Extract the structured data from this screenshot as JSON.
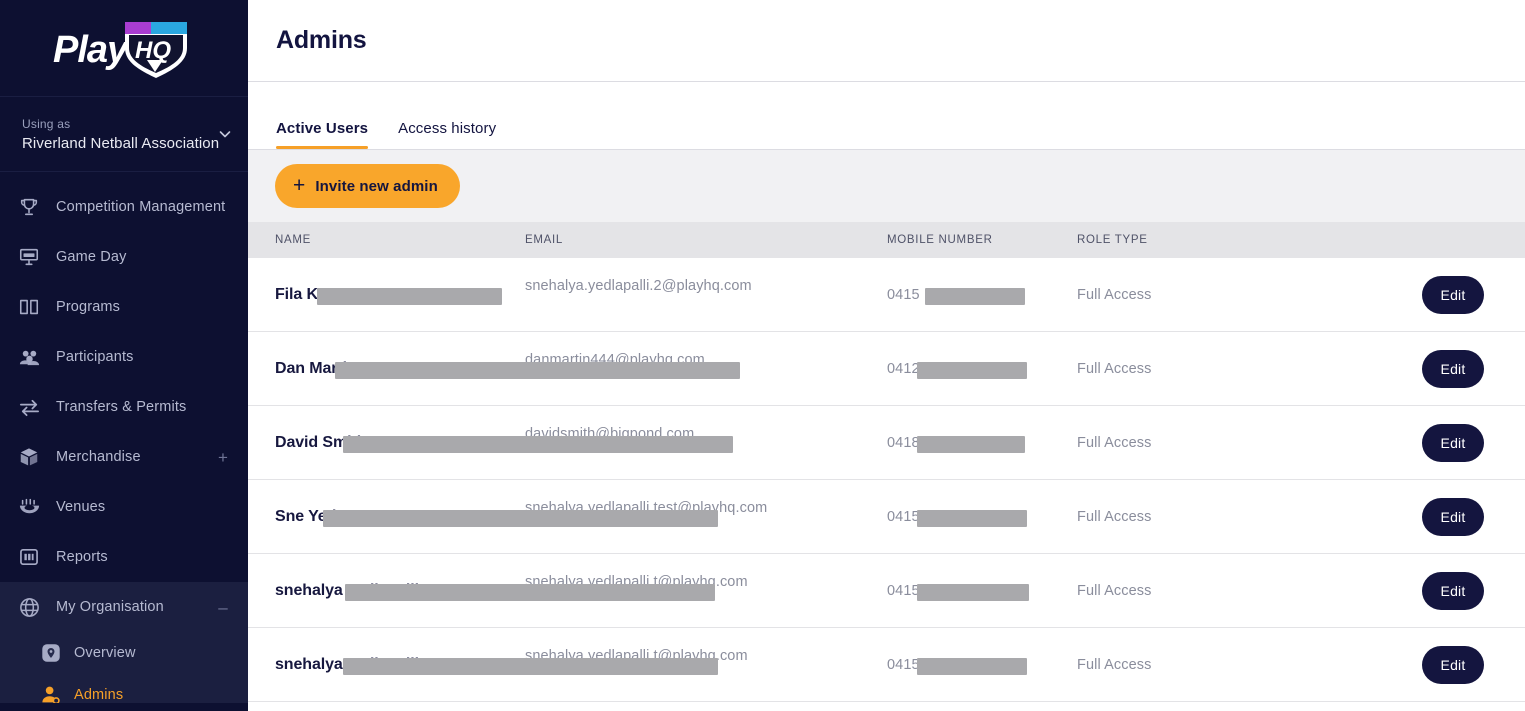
{
  "sidebar": {
    "logo_alt": "PlayHQ",
    "org_switcher": {
      "using_as_label": "Using as",
      "org_name": "Riverland Netball Association"
    },
    "items": [
      {
        "label": "Competition Management",
        "icon": "trophy-icon",
        "affordance": ""
      },
      {
        "label": "Game Day",
        "icon": "scoreboard-icon",
        "affordance": ""
      },
      {
        "label": "Programs",
        "icon": "book-icon",
        "affordance": ""
      },
      {
        "label": "Participants",
        "icon": "people-icon",
        "affordance": ""
      },
      {
        "label": "Transfers & Permits",
        "icon": "transfer-arrows-icon",
        "affordance": ""
      },
      {
        "label": "Merchandise",
        "icon": "box-icon",
        "affordance": "+"
      },
      {
        "label": "Venues",
        "icon": "stadium-icon",
        "affordance": ""
      },
      {
        "label": "Reports",
        "icon": "bar-chart-icon",
        "affordance": ""
      }
    ],
    "group": {
      "label": "My Organisation",
      "icon": "globe-icon",
      "affordance": "–",
      "subitems": [
        {
          "label": "Overview",
          "icon": "location-pin-icon",
          "active": false
        },
        {
          "label": "Admins",
          "icon": "admin-user-icon",
          "active": true
        }
      ]
    }
  },
  "header": {
    "title": "Admins"
  },
  "tabs": [
    {
      "label": "Active Users",
      "active": true
    },
    {
      "label": "Access history",
      "active": false
    }
  ],
  "toolbar": {
    "invite_label": "Invite new admin",
    "invite_icon": "plus-icon"
  },
  "table": {
    "columns": [
      "NAME",
      "EMAIL",
      "MOBILE NUMBER",
      "ROLE TYPE",
      ""
    ],
    "action_label": "Edit",
    "rows": [
      {
        "name": "Fila K",
        "email_visible": "2@playhq.com",
        "email_ghost": "snehalya.yedlapalli.",
        "mobile": "0415",
        "role": "Full Access",
        "action": "Edit"
      },
      {
        "name": "Dan Martin",
        "email_visible": ".com",
        "email_ghost": "danmartin444@playhq",
        "mobile": "0412",
        "role": "Full Access",
        "action": "Edit"
      },
      {
        "name": "David Smith",
        "email_visible": "om",
        "email_ghost": "davidsmith@bigpond.c",
        "mobile": "0418",
        "role": "Full Access",
        "action": "Edit"
      },
      {
        "name": "Sne Yed",
        "email_visible": "@playhq.com",
        "email_ghost": "snehalya.yedlapalli.test",
        "mobile": "0415",
        "role": "Full Access",
        "action": "Edit"
      },
      {
        "name": "snehalya yedlapalli",
        "email_visible": "playhq.com",
        "email_ghost": "snehalya.yedlapalli.t@",
        "mobile": "0415",
        "role": "Full Access",
        "action": "Edit"
      },
      {
        "name": "snehalya yedlapalli",
        "email_visible": "playhq.com",
        "email_ghost": "snehalya.yedlapalli.t@",
        "mobile": "0415",
        "role": "Full Access",
        "action": "Edit"
      }
    ]
  },
  "colors": {
    "sidebar_bg": "#0d1031",
    "sidebar_group_bg": "#1b1f40",
    "accent": "#f6a028",
    "navy": "#14153f",
    "toolbar_bg": "#f1f1f3",
    "thead_bg": "#e4e4e7",
    "redaction": "#a9a9ac"
  }
}
